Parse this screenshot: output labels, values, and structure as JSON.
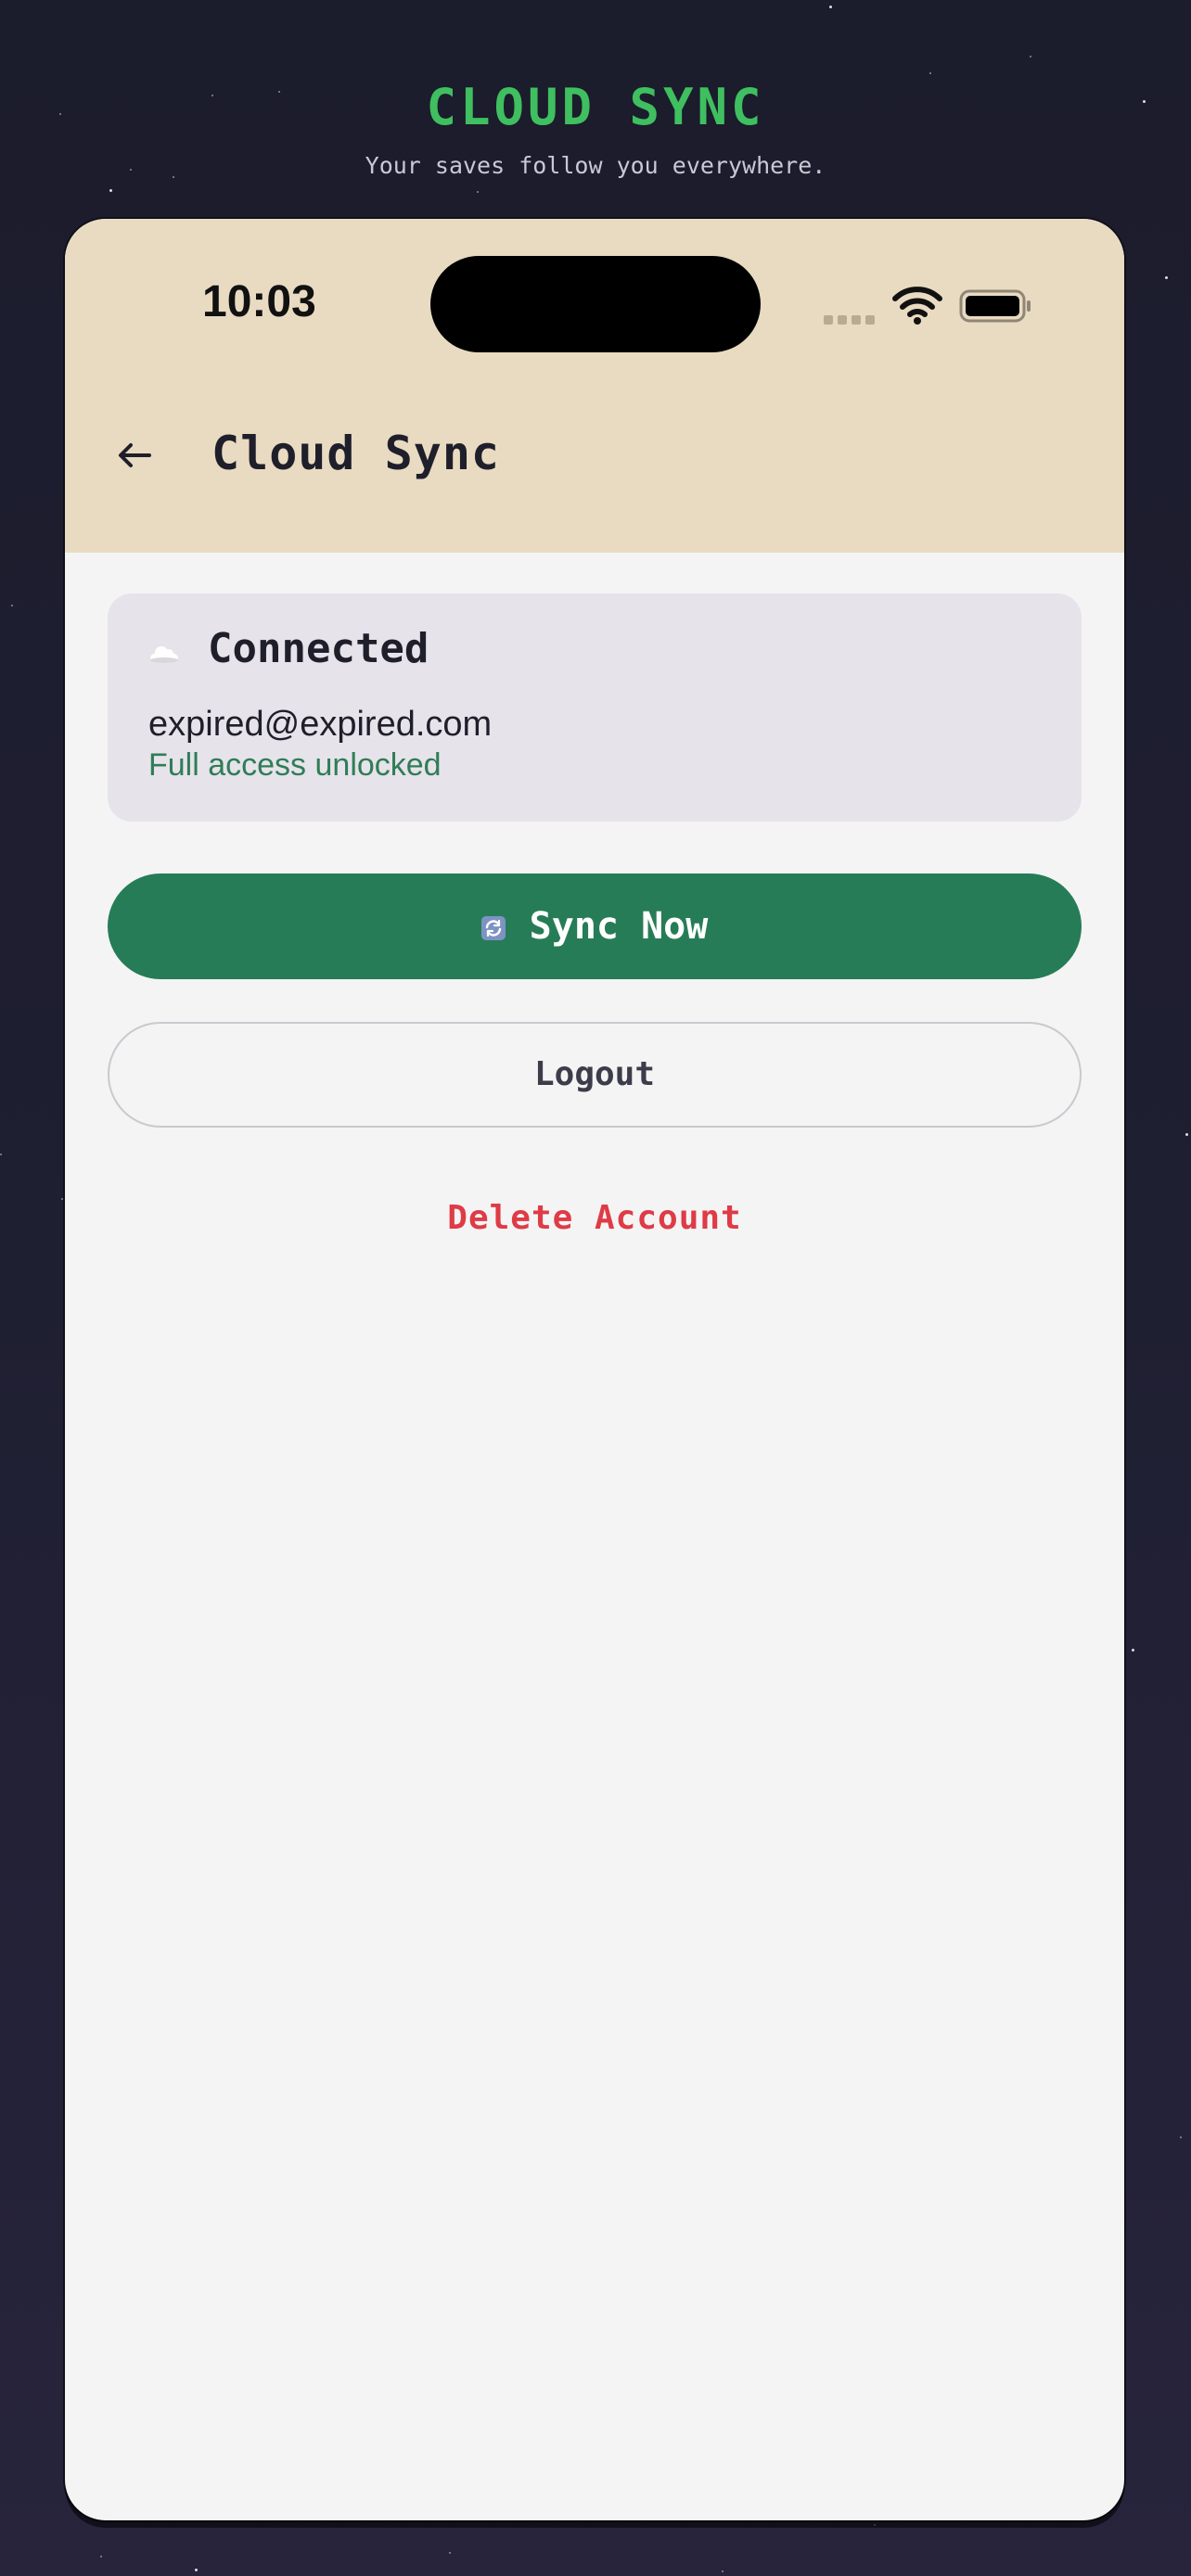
{
  "colors": {
    "background": "#1d1d2f",
    "accent_green": "#3fbf5f",
    "header_tan": "#e9dbc1",
    "sync_button": "#267c56",
    "delete_red": "#df3b46",
    "access_green": "#2f7d58"
  },
  "hero": {
    "title": "CLOUD SYNC",
    "subtitle": "Your saves follow you everywhere."
  },
  "status_bar": {
    "time": "10:03",
    "icons": [
      "signal-dots-icon",
      "wifi-icon",
      "battery-icon"
    ]
  },
  "header": {
    "back_icon": "arrow-left-icon",
    "title": "Cloud Sync"
  },
  "account_card": {
    "icon": "cloud-icon",
    "status": "Connected",
    "email": "expired@expired.com",
    "access_text": "Full access unlocked"
  },
  "actions": {
    "sync_icon": "sync-icon",
    "sync_label": "Sync Now",
    "logout_label": "Logout",
    "delete_label": "Delete Account"
  }
}
